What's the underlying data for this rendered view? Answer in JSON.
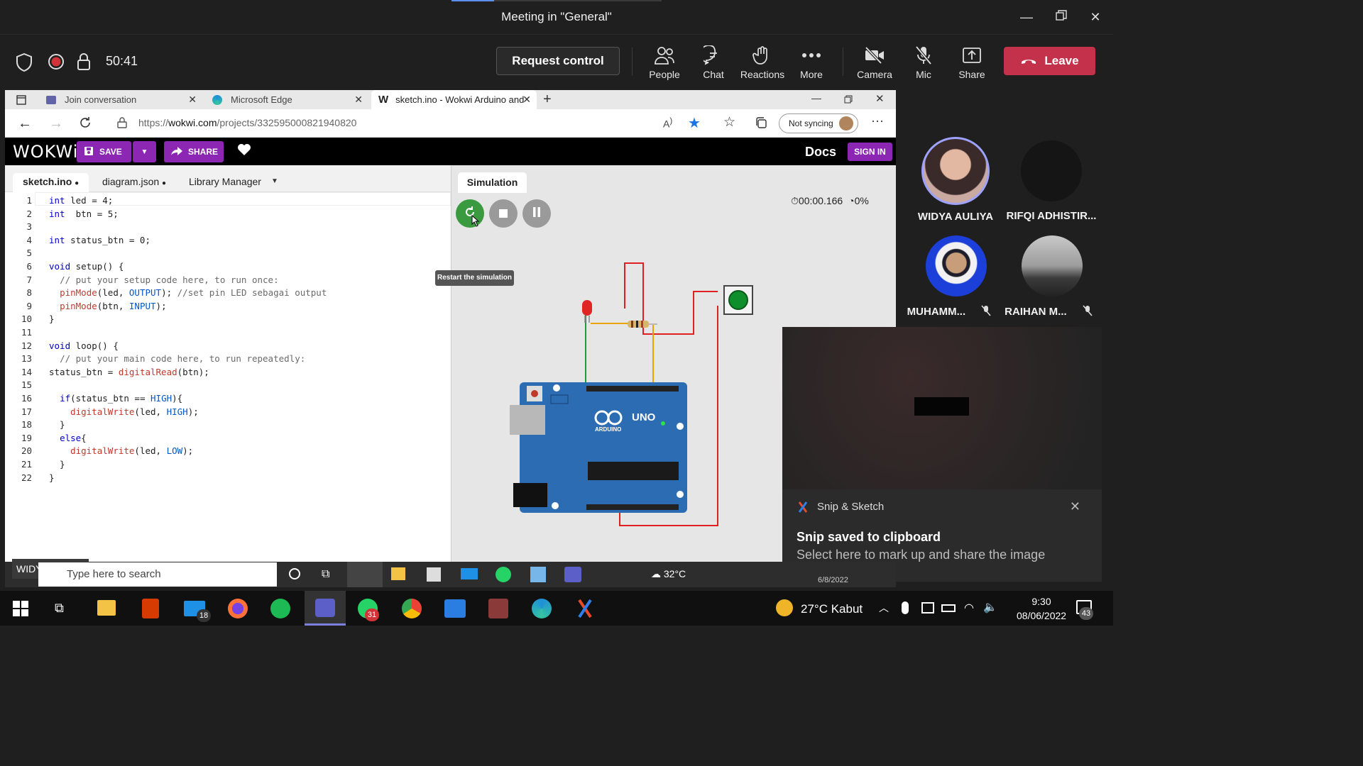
{
  "teams": {
    "title": "Meeting in \"General\"",
    "timer": "50:41",
    "request_control": "Request control",
    "toolbar": [
      {
        "label": "People",
        "icon": "people-icon"
      },
      {
        "label": "Chat",
        "icon": "chat-icon"
      },
      {
        "label": "Reactions",
        "icon": "reactions-icon"
      },
      {
        "label": "More",
        "icon": "more-icon"
      },
      {
        "label": "Camera",
        "icon": "camera-off-icon"
      },
      {
        "label": "Mic",
        "icon": "mic-off-icon"
      },
      {
        "label": "Share",
        "icon": "share-icon"
      }
    ],
    "leave": "Leave",
    "colors": {
      "leave": "#c4314b",
      "bg": "#1f1f1f"
    }
  },
  "browser": {
    "tabs": [
      {
        "label": "Join conversation"
      },
      {
        "label": "Microsoft Edge"
      },
      {
        "label": "sketch.ino - Wokwi Arduino and"
      }
    ],
    "url_prefix": "https://",
    "url_domain": "wokwi.com",
    "url_path": "/projects/332595000821940820",
    "sync": "Not syncing"
  },
  "wokwi": {
    "logo": "WOKWi",
    "save": "SAVE",
    "share": "SHARE",
    "docs": "Docs",
    "sign_in": "SIGN IN",
    "editor_tabs": [
      "sketch.ino",
      "diagram.json",
      "Library Manager"
    ],
    "sim_tab": "Simulation",
    "tooltip": "Restart the simulation",
    "sim_time": "00:00.166",
    "sim_speed": "0%",
    "board_label": "UNO",
    "board_brand": "ARDUINO",
    "colors": {
      "accent": "#8c27b4",
      "board": "#2b6cb3",
      "restart": "#3a9a3f"
    }
  },
  "code": [
    "int led = 4;",
    "int  btn = 5;",
    "",
    "int status_btn = 0;",
    "",
    "void setup() {",
    "  // put your setup code here, to run once:",
    "  pinMode(led, OUTPUT); //set pin LED sebagai output",
    "  pinMode(btn, INPUT);",
    "}",
    "",
    "void loop() {",
    "  // put your main code here, to run repeatedly:",
    "status_btn = digitalRead(btn);",
    "",
    "  if(status_btn == HIGH){",
    "    digitalWrite(led, HIGH);",
    "  }",
    "  else{",
    "    digitalWrite(led, LOW);",
    "  }",
    "}"
  ],
  "participants": [
    {
      "name": "WIDYA AULIYA",
      "muted": false
    },
    {
      "name": "RIFQI ADHISTIR...",
      "muted": false
    },
    {
      "name": "MUHAMM...",
      "muted": true
    },
    {
      "name": "RAIHAN M...",
      "muted": true
    }
  ],
  "notification": {
    "app": "Snip & Sketch",
    "title": "Snip saved to clipboard",
    "body": "Select here to mark up and share the image"
  },
  "shared_screen": {
    "presenter": "WIDYA AULIYA",
    "search_placeholder": "Type here to search",
    "temp": "32°C",
    "date": "6/8/2022"
  },
  "taskbar": {
    "weather": "27°C  Kabut",
    "time": "9:30",
    "date": "08/06/2022",
    "mail_badge": "18",
    "whatsapp_badge": "31",
    "notif_badge": "43"
  }
}
